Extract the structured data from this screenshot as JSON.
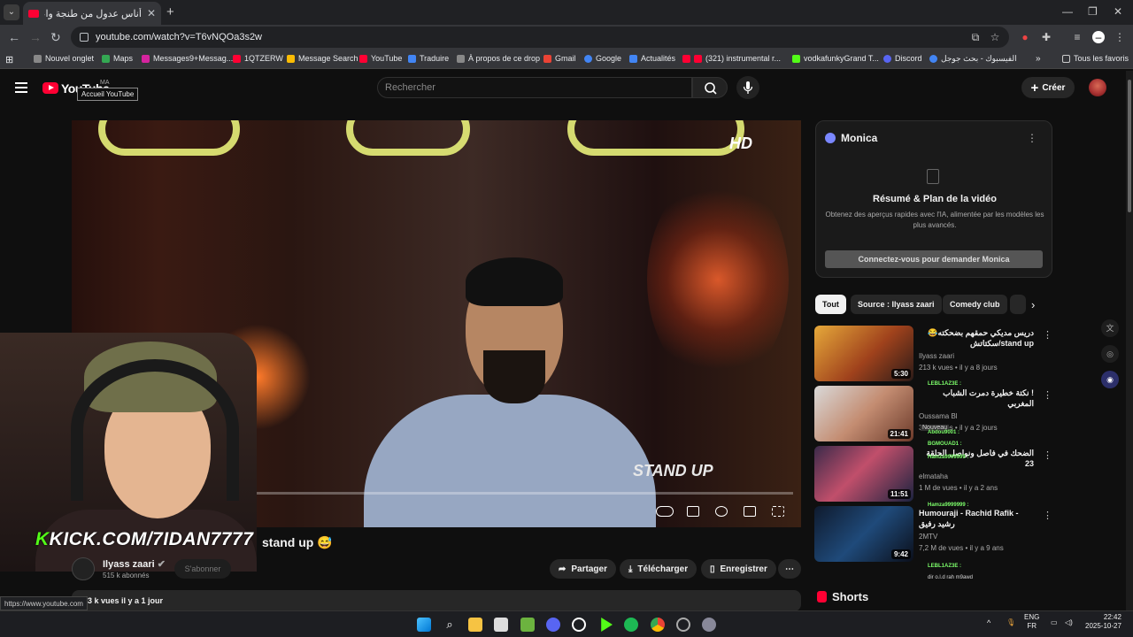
{
  "browser": {
    "tab_title": "أناس عدول من طنجة واعر براقة",
    "url": "youtube.com/watch?v=T6vNQOa3s2w",
    "status_url": "https://www.youtube.com",
    "bookmarks": [
      "Nouvel onglet",
      "Maps",
      "Messages9+Messag...",
      "1QTZERW",
      "Message Search",
      "YouTube",
      "Traduire",
      "À propos de ce drop",
      "Gmail",
      "Google",
      "Actualités",
      "(321) instrumental r...",
      "vodkafunkyGrand T...",
      "Discord",
      "الفيسبوك - بحث جوجل"
    ],
    "all_favorites": "Tous les favoris"
  },
  "youtube": {
    "logo_text": "YouTube",
    "country_code": "MA",
    "tooltip": "Accueil YouTube",
    "search_placeholder": "Rechercher",
    "create_label": "Créer"
  },
  "video": {
    "title": "stand up 😅",
    "overlay_brand": "HD",
    "overlay_watermark": "STAND UP",
    "streamer_overlay": "KICK.COM/7IDAN7777",
    "streamer_overlay_k": "K",
    "channel_name": "Ilyass zaari",
    "channel_subs": "515 k abonnés",
    "subscribe_label": "S'abonner",
    "actions": {
      "share": "Partager",
      "download": "Télécharger",
      "save": "Enregistrer"
    },
    "description_meta": "3 k vues  il y a 1 jour"
  },
  "monica": {
    "title": "Monica",
    "heading": "Résumé & Plan de la vidéo",
    "description": "Obtenez des aperçus rapides avec l'IA, alimentée par les modèles les plus avancés.",
    "button": "Connectez-vous pour demander Monica"
  },
  "chips": [
    "Tout",
    "Source : Ilyass zaari",
    "Comedy club"
  ],
  "recommendations": [
    {
      "title": "دريس مديكي حمقهم بضحكته😂 stand up/سكتاتش",
      "channel": "Ilyass zaari",
      "meta": "213 k vues • il y a 8 jours",
      "duration": "5:30"
    },
    {
      "title": "! نكتة خطيرة دمرت الشباب المغربي",
      "channel": "Oussama Bl",
      "meta": "309 k vues • il y a 2 jours",
      "duration": "21:41",
      "badge": "Nouveau"
    },
    {
      "title": "الضحك في فاصل ونواصل الحلقة 23",
      "channel": "elmataha",
      "meta": "1 M de vues • il y a 2 ans",
      "duration": "11:51"
    },
    {
      "title": "Humouraji - Rachid Rafik - رشيد رفيق",
      "channel": "2MTV",
      "meta": "7,2 M de vues • il y a 9 ans",
      "duration": "9:42"
    }
  ],
  "chat_overlay": [
    "LEBL1AZ3E :",
    "BGMOUAD1 :",
    "Hamza9999999 :",
    "Abdou9001 :",
    "Hamza9999999 :",
    "LEBL1AZ3E :",
    "dir o.l.d rah m9awd"
  ],
  "shorts_label": "Shorts",
  "taskbar": {
    "lang": "ENG",
    "lang2": "FR",
    "time": "22:42",
    "date": "2025-10-27"
  }
}
